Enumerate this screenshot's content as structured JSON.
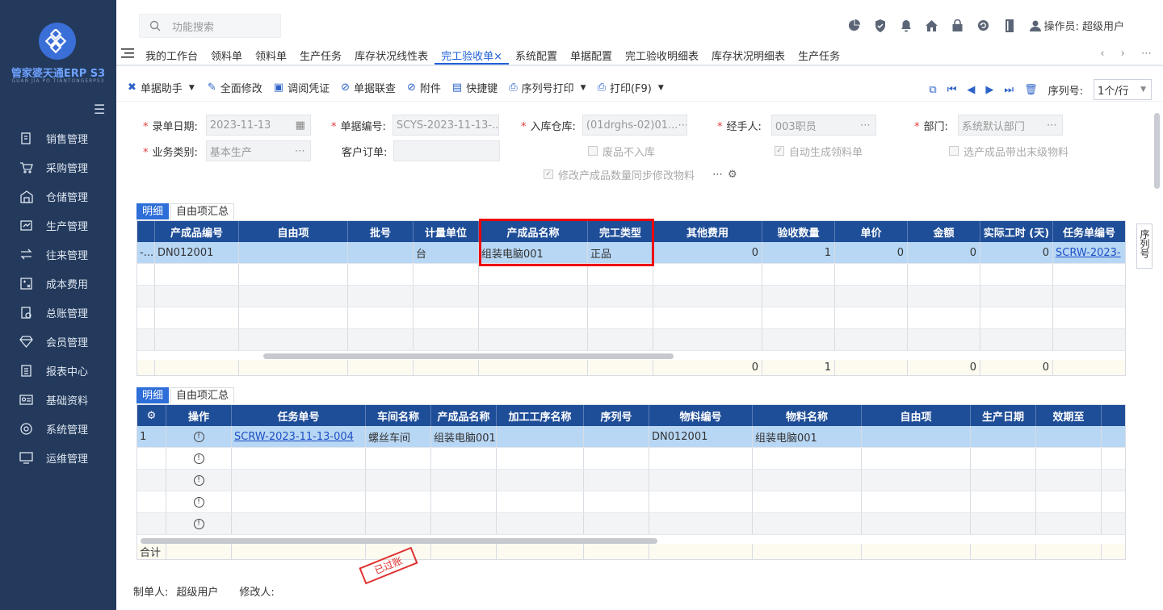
{
  "sidebar": {
    "brand": "管家婆天通ERP S3",
    "brand_sub": "GUAN JIA PO TIANTONGERPS3",
    "items": [
      {
        "label": "销售管理",
        "icon": "sales-icon"
      },
      {
        "label": "采购管理",
        "icon": "cart-icon"
      },
      {
        "label": "仓储管理",
        "icon": "warehouse-icon"
      },
      {
        "label": "生产管理",
        "icon": "production-icon"
      },
      {
        "label": "往来管理",
        "icon": "exchange-icon"
      },
      {
        "label": "成本费用",
        "icon": "cost-icon"
      },
      {
        "label": "总账管理",
        "icon": "ledger-icon"
      },
      {
        "label": "会员管理",
        "icon": "diamond-icon"
      },
      {
        "label": "报表中心",
        "icon": "report-icon"
      },
      {
        "label": "基础资料",
        "icon": "id-card-icon"
      },
      {
        "label": "系统管理",
        "icon": "gear-icon"
      },
      {
        "label": "运维管理",
        "icon": "monitor-icon"
      }
    ]
  },
  "topbar": {
    "search_placeholder": "功能搜索",
    "user_label": "操作员: 超级用户"
  },
  "tabs": [
    "我的工作台",
    "领料单",
    "领料单",
    "生产任务",
    "库存状况线性表",
    "完工验收单",
    "系统配置",
    "单据配置",
    "完工验收明细表",
    "库存状况明细表",
    "生产任务"
  ],
  "active_tab": 5,
  "toolbar": {
    "items": [
      "单据助手",
      "全面修改",
      "调阅凭证",
      "单据联查",
      "附件",
      "快捷键",
      "序列号打印",
      "打印(F9)"
    ],
    "seq_label": "序列号:",
    "seq_value": "1个/行"
  },
  "form": {
    "date_label": "录单日期:",
    "date_value": "2023-11-13",
    "no_label": "单据编号:",
    "no_value": "SCYS-2023-11-13-...",
    "wh_label": "入库仓库:",
    "wh_value": "(01drghs-02)01...",
    "handler_label": "经手人:",
    "handler_value": "003职员",
    "dept_label": "部门:",
    "dept_value": "系统默认部门",
    "biz_label": "业务类别:",
    "biz_value": "基本生产",
    "cust_label": "客户订单:",
    "cust_value": "",
    "chk_waste": "废品不入库",
    "chk_auto": "自动生成领料单",
    "chk_select": "选产成品带出末级物料",
    "chk_sync": "修改产成品数量同步修改物料"
  },
  "grid1": {
    "tabs": [
      "明细",
      "自由项汇总"
    ],
    "headers": [
      "",
      "产成品编号",
      "自由项",
      "批号",
      "计量单位",
      "产成品名称",
      "完工类型",
      "其他费用",
      "验收数量",
      "单价",
      "金额",
      "实际工时 (天)",
      "任务单编号"
    ],
    "row": [
      "-...",
      "DN012001",
      "",
      "",
      "台",
      "组装电脑001",
      "正品",
      "0",
      "1",
      "0",
      "0",
      "0",
      "SCRW-2023-"
    ],
    "sum": [
      "",
      "",
      "",
      "",
      "",
      "",
      "",
      "0",
      "1",
      "",
      "0",
      "0",
      ""
    ]
  },
  "grid2": {
    "tabs": [
      "明细",
      "自由项汇总"
    ],
    "headers": [
      "",
      "操作",
      "任务单号",
      "车间名称",
      "产成品名称",
      "加工工序名称",
      "序列号",
      "物料编号",
      "物料名称",
      "自由项",
      "生产日期",
      "效期至"
    ],
    "row": [
      "1",
      "",
      "SCRW-2023-11-13-004",
      "螺丝车间",
      "组装电脑001",
      "",
      "",
      "DN012001",
      "组装电脑001",
      "",
      "",
      ""
    ],
    "sum_label": "合计"
  },
  "side_tab": "序列号",
  "stamp": "已过账",
  "footer": {
    "maker_label": "制单人:",
    "maker": "超级用户",
    "modifier_label": "修改人:"
  }
}
